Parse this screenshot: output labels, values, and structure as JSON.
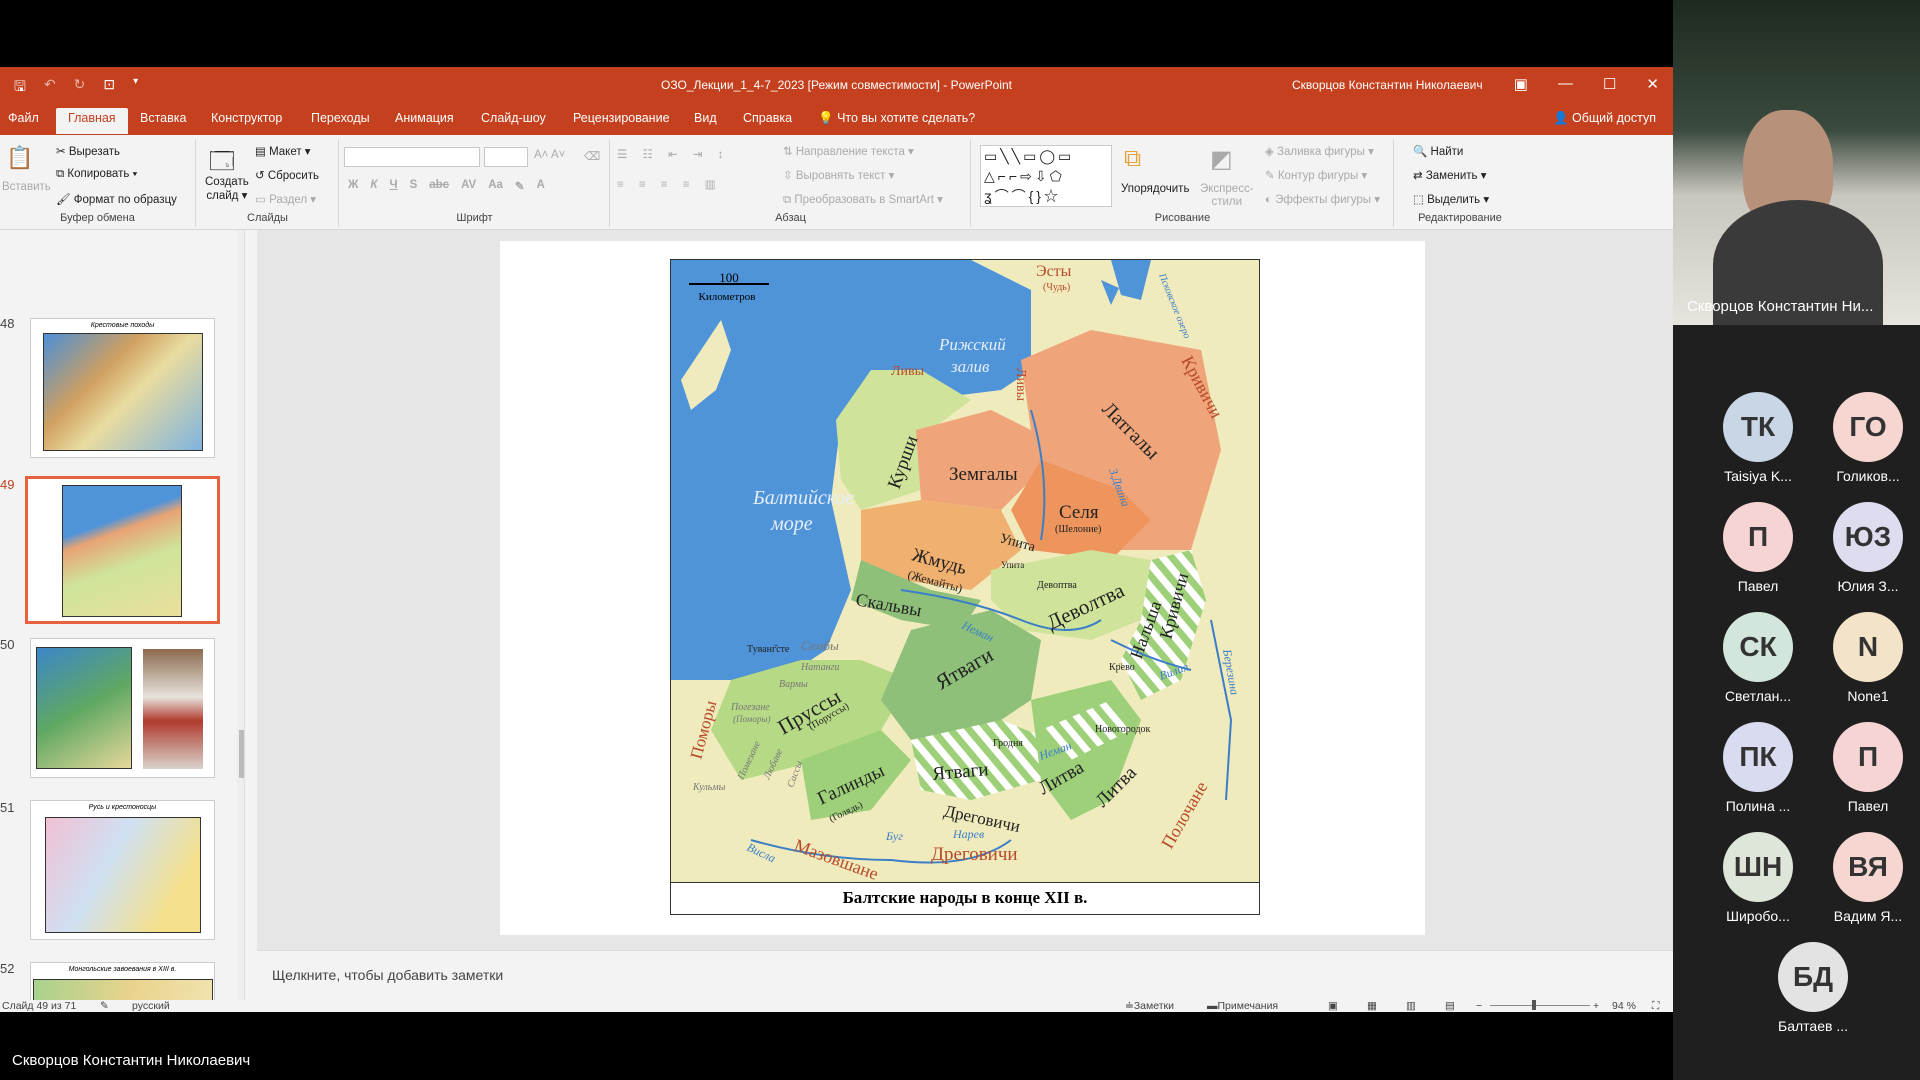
{
  "window": {
    "title": "ОЗО_Лекции_1_4-7_2023 [Режим совместимости] - PowerPoint",
    "user": "Скворцов Константин Николаевич"
  },
  "tabs": [
    {
      "label": "Файл"
    },
    {
      "label": "Главная",
      "active": true
    },
    {
      "label": "Вставка"
    },
    {
      "label": "Конструктор"
    },
    {
      "label": "Переходы"
    },
    {
      "label": "Анимация"
    },
    {
      "label": "Слайд-шоу"
    },
    {
      "label": "Рецензирование"
    },
    {
      "label": "Вид"
    },
    {
      "label": "Справка"
    }
  ],
  "tell_me": "Что вы хотите сделать?",
  "share": "Общий доступ",
  "ribbon": {
    "clipboard": {
      "paste": "Вставить",
      "cut": "Вырезать",
      "copy": "Копировать",
      "format_painter": "Формат по образцу",
      "label": "Буфер обмена"
    },
    "slides": {
      "new_slide_1": "Создать",
      "new_slide_2": "слайд",
      "layout": "Макет",
      "reset": "Сбросить",
      "section": "Раздел",
      "label": "Слайды"
    },
    "font": {
      "label": "Шрифт",
      "bold": "Ж",
      "italic": "К",
      "underline": "Ч",
      "shadow": "S",
      "strike": "abc",
      "spacing": "AV",
      "case": "Aa"
    },
    "paragraph": {
      "direction": "Направление текста",
      "align": "Выровнять текст",
      "smartart": "Преобразовать в SmartArt",
      "label": "Абзац"
    },
    "drawing": {
      "arrange": "Упорядочить",
      "quick_styles_1": "Экспресс-",
      "quick_styles_2": "стили",
      "fill": "Заливка фигуры",
      "outline": "Контур фигуры",
      "effects": "Эффекты фигуры",
      "label": "Рисование"
    },
    "editing": {
      "find": "Найти",
      "replace": "Заменить",
      "select": "Выделить",
      "label": "Редактирование"
    }
  },
  "thumbnails": [
    {
      "num": "48",
      "title": "Крестовые походы"
    },
    {
      "num": "49",
      "selected": true
    },
    {
      "num": "50"
    },
    {
      "num": "51",
      "title": "Русь и крестоносцы"
    },
    {
      "num": "52",
      "title": "Монгольские завоевания в XIII в."
    }
  ],
  "slide": {
    "caption": "Балтские народы в конце XII в.",
    "map": {
      "scale_value": "100",
      "scale_unit": "Километров",
      "sea_1": "Балтийское",
      "sea_2": "море",
      "gulf_1": "Рижский",
      "gulf_2": "залив",
      "peoples": [
        "Эсты",
        "(Чудь)",
        "Псковское озеро",
        "Кривичи",
        "Ливы",
        "Ливы",
        "Курши",
        "Земгалы",
        "Латгалы",
        "Селя",
        "(Шелоние)",
        "З.Двина",
        "Жмудь",
        "(Жемайты)",
        "Упита",
        "Упита",
        "Девоптва",
        "Деволтва",
        "Скальвы",
        "Сембы",
        "Натанги",
        "Вармы",
        "Туванг̆сте",
        "Неман",
        "Ятваги",
        "Кр̈ево",
        "Нальша",
        "Кривичи",
        "Вилия",
        "Березина",
        "Пруссы",
        "(Поруссы)",
        "Погезане",
        "(Поморы)",
        "Поморы",
        "Помезане",
        "Любаве",
        "Сассы",
        "Кульмы",
        "Галинды",
        "(Голядь)",
        "Гродня",
        "Новогородок",
        "Неман",
        "Ятваги",
        "Литва",
        "Литва",
        "Дреговичи",
        "Нарев",
        "Буг",
        "Висла",
        "Мазовшане",
        "Дреговичи",
        "Полочане",
        "Нарва",
        "Двина"
      ]
    }
  },
  "notes_placeholder": "Щелкните, чтобы добавить заметки",
  "status": {
    "slide_count": "Слайд 49 из 71",
    "language": "русский",
    "notes": "Заметки",
    "comments": "Примечания",
    "zoom": "94 %"
  },
  "teams": {
    "presenter_video_name": "Скворцов Константин Ни...",
    "participants": [
      {
        "initials": "ТК",
        "name": "Taisiya K...",
        "color": "#c9d6e6"
      },
      {
        "initials": "ГО",
        "name": "Голиков...",
        "color": "#f5d6d0"
      },
      {
        "initials": "П",
        "name": "Павел",
        "color": "#f6d4d4"
      },
      {
        "initials": "ЮЗ",
        "name": "Юлия З...",
        "color": "#dedcef"
      },
      {
        "initials": "СК",
        "name": "Светлан...",
        "color": "#d3e6dc"
      },
      {
        "initials": "N",
        "name": "None1",
        "color": "#f3e3c9"
      },
      {
        "initials": "ПК",
        "name": "Полина ...",
        "color": "#d9dcf0"
      },
      {
        "initials": "П",
        "name": "Павел",
        "color": "#f6d4d4"
      },
      {
        "initials": "ШН",
        "name": "Широбо...",
        "color": "#dde6d8"
      },
      {
        "initials": "ВЯ",
        "name": "Вадим Я...",
        "color": "#f5d6d0"
      },
      {
        "initials": "БД",
        "name": "Балтаев ...",
        "color": "#e3e3e3"
      }
    ],
    "bottom_name": "Скворцов Константин Николаевич"
  }
}
